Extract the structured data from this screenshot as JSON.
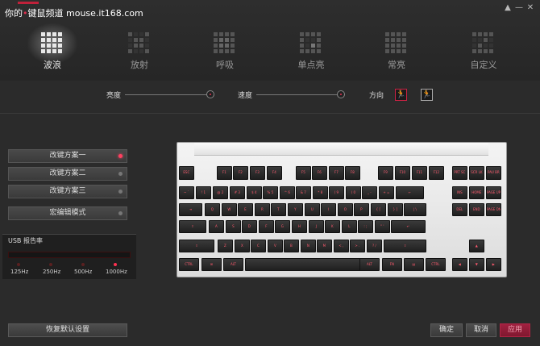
{
  "watermark": {
    "brand": "你的",
    "dot": "•",
    "rest": "键鼠频道 mouse.it168.com"
  },
  "window_controls": {
    "up": "▲",
    "min": "—",
    "close": "✕"
  },
  "modes": [
    {
      "label": "波浪",
      "active": true
    },
    {
      "label": "放射",
      "active": false
    },
    {
      "label": "呼吸",
      "active": false
    },
    {
      "label": "单点亮",
      "active": false
    },
    {
      "label": "常亮",
      "active": false
    },
    {
      "label": "自定义",
      "active": false
    }
  ],
  "controls": {
    "brightness_label": "亮度",
    "speed_label": "速度",
    "direction_label": "方向",
    "direction_left": "🏃",
    "direction_right": "🏃"
  },
  "profiles": [
    {
      "label": "改键方案一",
      "active": true
    },
    {
      "label": "改键方案二",
      "active": false
    },
    {
      "label": "改键方案三",
      "active": false
    },
    {
      "label": "宏编辑模式",
      "active": false
    }
  ],
  "usb": {
    "title": "USB 报告率",
    "rates": [
      "125Hz",
      "250Hz",
      "500Hz",
      "1000Hz"
    ],
    "selected": "1000Hz"
  },
  "keyboard": {
    "rows": [
      [
        "ESC",
        "F1",
        "F2",
        "F3",
        "F4",
        "F5",
        "F6",
        "F7",
        "F8",
        "F9",
        "F10",
        "F11",
        "F12",
        "PRT SC",
        "SCR LK",
        "PAU BR"
      ],
      [
        "~ `",
        "! 1",
        "@ 2",
        "# 3",
        "$ 4",
        "% 5",
        "^ 6",
        "& 7",
        "* 8",
        "( 9",
        ") 0",
        "_ -",
        "+ =",
        "←",
        "INS",
        "HOME",
        "PAGE UP"
      ],
      [
        "⇥",
        "Q",
        "W",
        "E",
        "R",
        "T",
        "Y",
        "U",
        "I",
        "O",
        "P",
        "{ [",
        "} ]",
        "| \\",
        "DEL",
        "END",
        "PAGE DN"
      ],
      [
        "⇪",
        "A",
        "S",
        "D",
        "F",
        "G",
        "H",
        "J",
        "K",
        "L",
        ": ;",
        "\" '",
        "↵"
      ],
      [
        "⇧",
        "Z",
        "X",
        "C",
        "V",
        "B",
        "N",
        "M",
        "< ,",
        "> .",
        "? /",
        "⇧",
        "▲"
      ],
      [
        "CTRL",
        "⊞",
        "ALT",
        "",
        "ALT",
        "FN",
        "▤",
        "CTRL",
        "◀",
        "▼",
        "▶"
      ]
    ]
  },
  "footer": {
    "reset": "恢复默认设置",
    "ok": "确定",
    "cancel": "取消",
    "apply": "应用"
  },
  "colors": {
    "accent": "#e03050",
    "background": "#2b2b2b"
  }
}
